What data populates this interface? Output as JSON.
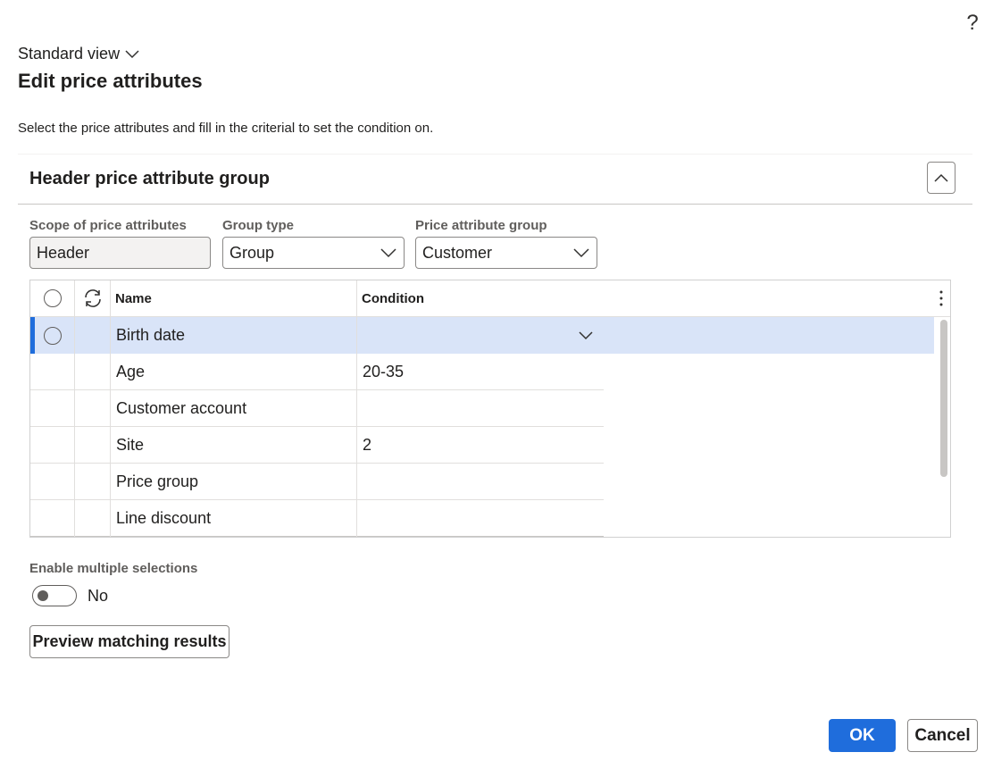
{
  "header": {
    "help_icon": "?",
    "view_selector": "Standard view",
    "title": "Edit price attributes",
    "instruction": "Select the price attributes and fill in the criterial to set the condition on."
  },
  "section": {
    "title": "Header price attribute group"
  },
  "filters": {
    "scope": {
      "label": "Scope of price attributes",
      "value": "Header"
    },
    "group_type": {
      "label": "Group type",
      "value": "Group"
    },
    "price_attribute_group": {
      "label": "Price attribute group",
      "value": "Customer"
    }
  },
  "grid": {
    "columns": [
      "Name",
      "Condition"
    ],
    "rows": [
      {
        "name": "Birth date",
        "condition": "",
        "selected": true
      },
      {
        "name": "Age",
        "condition": "20-35",
        "selected": false
      },
      {
        "name": "Customer account",
        "condition": "",
        "selected": false
      },
      {
        "name": "Site",
        "condition": "2",
        "selected": false
      },
      {
        "name": "Price group",
        "condition": "",
        "selected": false
      },
      {
        "name": "Line discount",
        "condition": "",
        "selected": false
      }
    ]
  },
  "multi_select": {
    "label": "Enable multiple selections",
    "state": "No"
  },
  "buttons": {
    "preview": "Preview matching results",
    "ok": "OK",
    "cancel": "Cancel"
  },
  "colors": {
    "primary": "#1f6ddc",
    "selected_row": "#d9e4f8",
    "selected_marker": "#1f6ddc"
  }
}
